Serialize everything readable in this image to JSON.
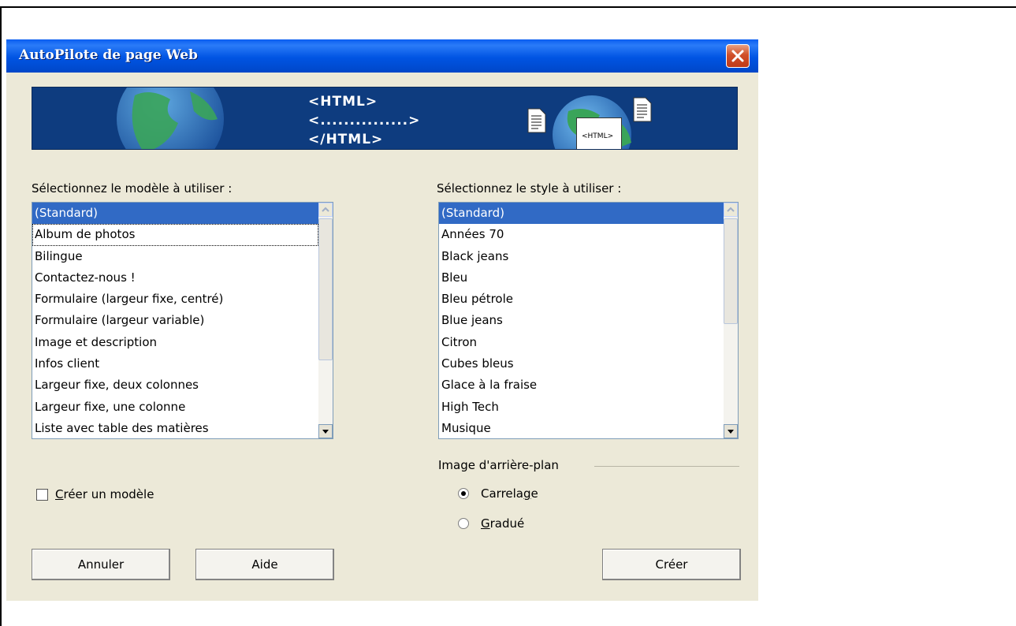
{
  "window": {
    "title": "AutoPilote de page Web"
  },
  "banner": {
    "line1": "<HTML>",
    "line2": "<...............>",
    "line3": "</HTML>",
    "doc_label": "<HTML>"
  },
  "template_panel": {
    "label": "Sélectionnez le modèle à utiliser :",
    "items": [
      "(Standard)",
      "Album de photos",
      "Bilingue",
      "Contactez-nous !",
      "Formulaire (largeur fixe, centré)",
      "Formulaire (largeur variable)",
      "Image et description",
      "Infos client",
      "Largeur fixe, deux colonnes",
      "Largeur fixe, une colonne",
      "Liste avec table des matières"
    ],
    "selected_index": 0
  },
  "style_panel": {
    "label": "Sélectionnez le style à utiliser :",
    "items": [
      "(Standard)",
      "Années 70",
      "Black jeans",
      "Bleu",
      "Bleu pétrole",
      "Blue jeans",
      "Citron",
      "Cubes bleus",
      "Glace à la fraise",
      "High Tech",
      "Musique"
    ],
    "selected_index": 0
  },
  "create_template": {
    "label_mnemonic": "C",
    "label_rest": "réer un modèle",
    "checked": false
  },
  "background_image": {
    "label": "Image d'arrière-plan",
    "options": [
      {
        "label_pre": "Carrela",
        "mnemonic": "g",
        "label_post": "e",
        "checked": true
      },
      {
        "label_pre": "",
        "mnemonic": "G",
        "label_post": "radué",
        "checked": false
      }
    ]
  },
  "buttons": {
    "cancel": "Annuler",
    "help": "Aide",
    "create": "Créer"
  },
  "colors": {
    "titlebar": "#0054e3",
    "selection": "#316ac5",
    "dialog_bg": "#ece9d8",
    "banner_bg": "#0e3c7f"
  }
}
